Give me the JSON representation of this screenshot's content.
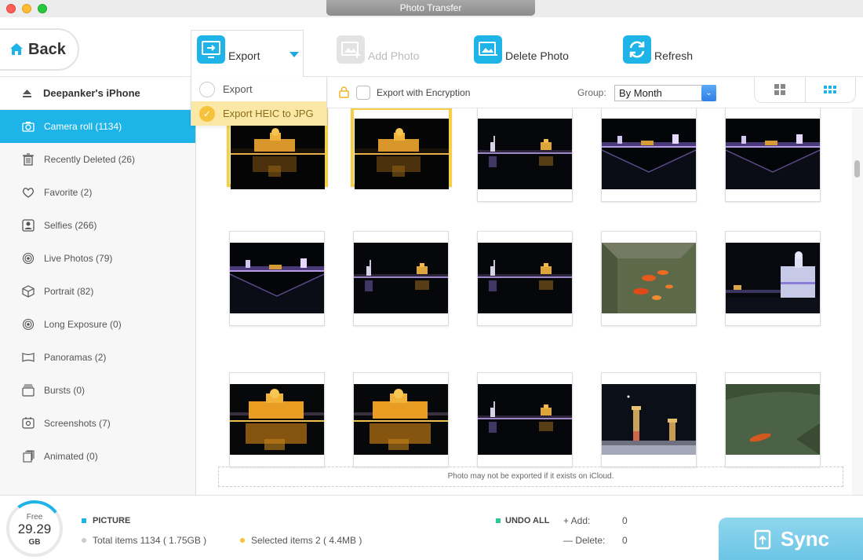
{
  "window": {
    "title": "Photo Transfer"
  },
  "toolbar": {
    "back_label": "Back",
    "export_label": "Export",
    "add_photo_label": "Add Photo",
    "delete_photo_label": "Delete Photo",
    "refresh_label": "Refresh"
  },
  "export_menu": {
    "items": [
      {
        "label": "Export",
        "selected": false
      },
      {
        "label": "Export HEIC to JPG",
        "selected": true
      }
    ]
  },
  "sidebar": {
    "device_name": "Deepanker's iPhone",
    "items": [
      {
        "label": "Camera roll (1134)",
        "icon": "camera-icon",
        "active": true
      },
      {
        "label": "Recently Deleted (26)",
        "icon": "trash-icon",
        "active": false
      },
      {
        "label": "Favorite (2)",
        "icon": "heart-icon",
        "active": false
      },
      {
        "label": "Selfies (266)",
        "icon": "selfie-icon",
        "active": false
      },
      {
        "label": "Live Photos (79)",
        "icon": "live-photo-icon",
        "active": false
      },
      {
        "label": "Portrait (82)",
        "icon": "cube-icon",
        "active": false
      },
      {
        "label": "Long Exposure (0)",
        "icon": "long-exposure-icon",
        "active": false
      },
      {
        "label": "Panoramas (2)",
        "icon": "panorama-icon",
        "active": false
      },
      {
        "label": "Bursts (0)",
        "icon": "bursts-icon",
        "active": false
      },
      {
        "label": "Screenshots (7)",
        "icon": "screenshot-icon",
        "active": false
      },
      {
        "label": "Animated (0)",
        "icon": "animated-icon",
        "active": false
      }
    ]
  },
  "subbar": {
    "encryption_label": "Export with Encryption",
    "group_label": "Group:",
    "group_value": "By Month"
  },
  "photos": [
    {
      "scene": "golden-temple-night",
      "selected": true
    },
    {
      "scene": "golden-temple-night",
      "selected": true
    },
    {
      "scene": "temple-reflection",
      "selected": false
    },
    {
      "scene": "purple-lights-reflection",
      "selected": false
    },
    {
      "scene": "purple-lights-reflection",
      "selected": false
    },
    {
      "scene": "purple-lights-reflection",
      "selected": false
    },
    {
      "scene": "temple-reflection",
      "selected": false
    },
    {
      "scene": "temple-reflection",
      "selected": false
    },
    {
      "scene": "koi-fish-pond",
      "selected": false
    },
    {
      "scene": "illuminated-building",
      "selected": false
    },
    {
      "scene": "golden-temple-bright",
      "selected": false
    },
    {
      "scene": "golden-temple-bright",
      "selected": false
    },
    {
      "scene": "temple-reflection",
      "selected": false
    },
    {
      "scene": "towers-night-sky",
      "selected": false
    },
    {
      "scene": "single-fish-pond",
      "selected": false
    }
  ],
  "icloud_note": "Photo may not be exported if it exists on iCloud.",
  "status": {
    "free_label": "Free",
    "free_value": "29.29",
    "free_unit": "GB",
    "category_label": "PICTURE",
    "total_items": "Total items 1134 ( 1.75GB )",
    "selected_items": "Selected items 2 ( 4.4MB )",
    "undo_label": "UNDO ALL",
    "add_label": "+ Add:",
    "add_value": "0",
    "delete_label": "— Delete:",
    "delete_value": "0",
    "sync_label": "Sync"
  },
  "colors": {
    "accent": "#1fb4e8",
    "selection": "#f5cf48",
    "dropdown_selected_bg": "#fbe8a6"
  }
}
